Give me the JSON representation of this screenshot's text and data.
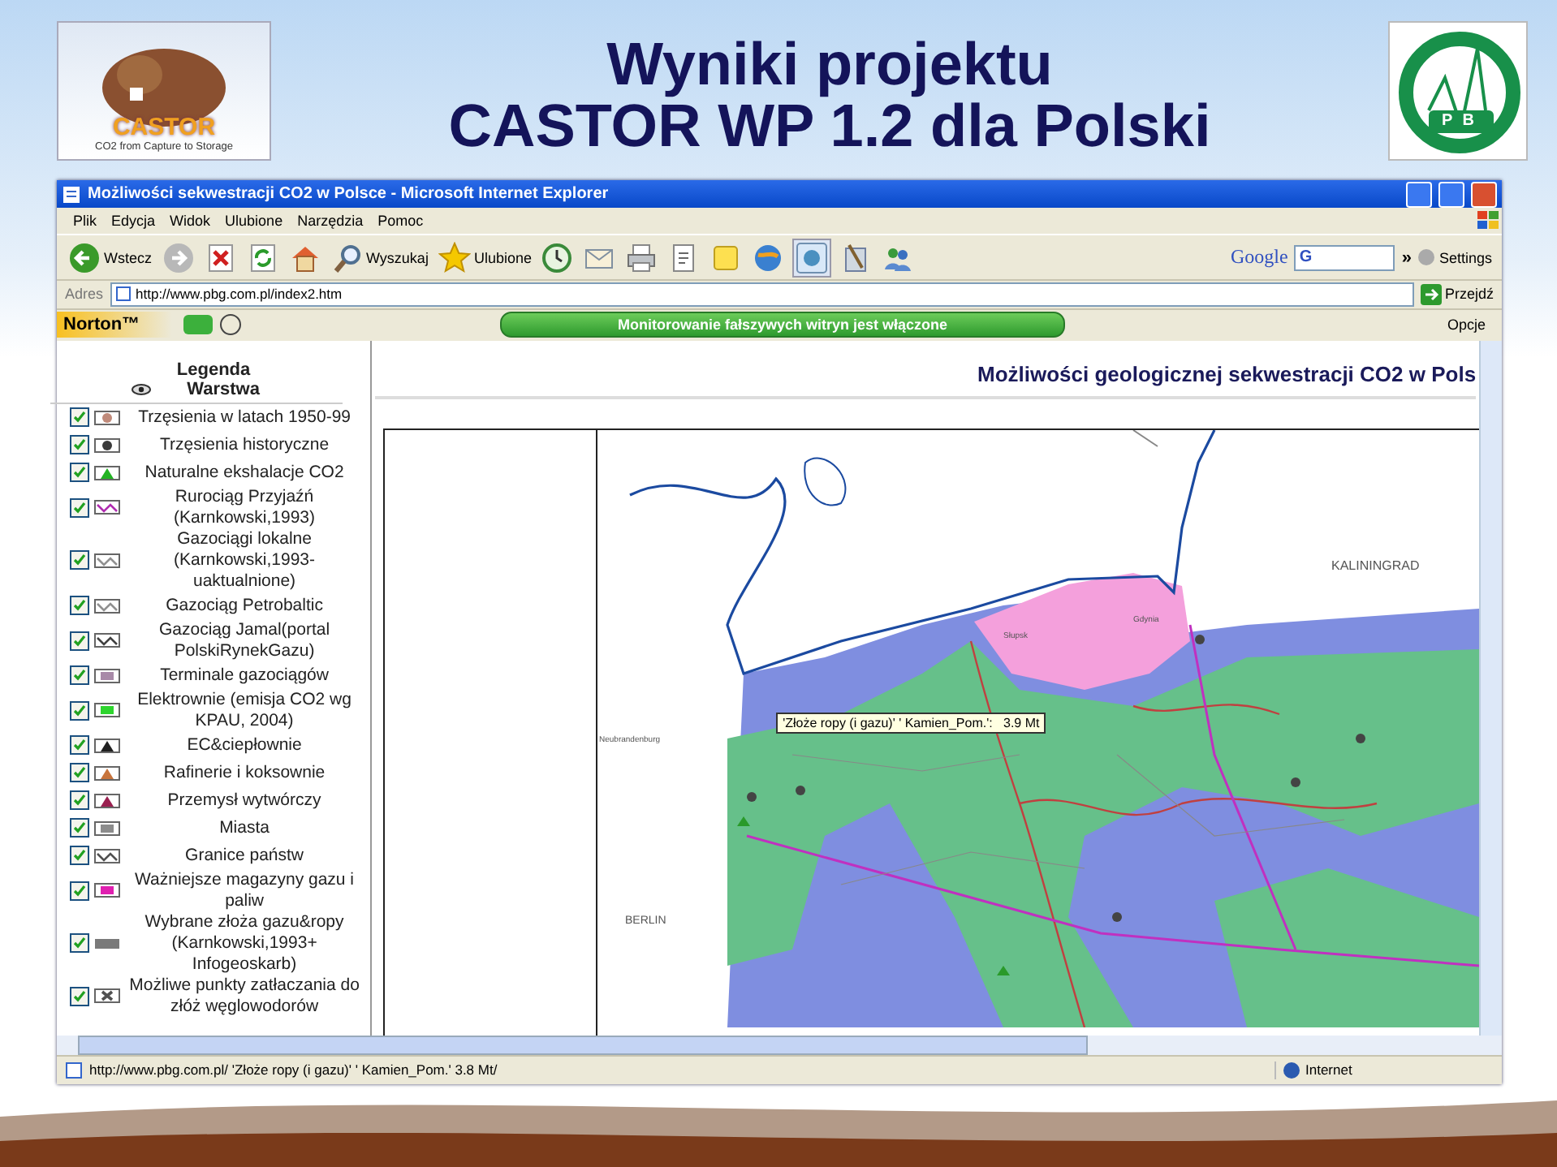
{
  "slide": {
    "title_lines": [
      "Wyniki projektu",
      "CASTOR WP 1.2 dla Polski"
    ],
    "logo_left": {
      "name": "CASTOR",
      "tagline": "CO2 from Capture to Storage"
    },
    "logo_right": {
      "letters": [
        "P",
        "B"
      ]
    }
  },
  "browser": {
    "title": "Możliwości sekwestracji CO2 w Polsce - Microsoft Internet Explorer",
    "menu": [
      "Plik",
      "Edycja",
      "Widok",
      "Ulubione",
      "Narzędzia",
      "Pomoc"
    ],
    "toolbar": [
      {
        "kind": "back",
        "label": "Wstecz"
      },
      {
        "kind": "forward"
      },
      {
        "kind": "stop"
      },
      {
        "kind": "refresh"
      },
      {
        "kind": "home"
      },
      {
        "kind": "search",
        "label": "Wyszukaj"
      },
      {
        "kind": "favorites",
        "label": "Ulubione"
      },
      {
        "kind": "history"
      },
      {
        "kind": "mail"
      },
      {
        "kind": "print"
      },
      {
        "kind": "edit"
      },
      {
        "kind": "note"
      },
      {
        "kind": "messenger"
      },
      {
        "kind": "research"
      },
      {
        "kind": "tools"
      },
      {
        "kind": "people"
      }
    ],
    "google": {
      "label": "Google",
      "field": "G",
      "more": "»",
      "settings": "Settings"
    },
    "address": {
      "label": "Adres",
      "url": "http://www.pbg.com.pl/index2.htm",
      "go": "Przejdź"
    },
    "norton": {
      "label": "Norton™",
      "banner": "Monitorowanie fałszywych witryn jest włączone",
      "options": "Opcje"
    },
    "status": {
      "text": "http://www.pbg.com.pl/ 'Złoże ropy (i gazu)' ' Kamien_Pom.'  3.8 Mt/",
      "zone": "Internet"
    }
  },
  "legend": {
    "title": "Legenda",
    "column": "Warstwa",
    "items": [
      {
        "label": "Trzęsienia w latach 1950-99",
        "checked": true,
        "kind": "dot",
        "color": "#c08a7a"
      },
      {
        "label": "Trzęsienia historyczne",
        "checked": true,
        "kind": "dot",
        "color": "#3a3a3a"
      },
      {
        "label": "Naturalne ekshalacje CO2",
        "checked": true,
        "kind": "triangle",
        "color": "#22b322"
      },
      {
        "label": "Rurociąg Przyjaźń (Karnkowski,1993)",
        "checked": true,
        "kind": "zigzag",
        "color": "#b02cb0"
      },
      {
        "label": "Gazociągi lokalne (Karnkowski,1993-uaktualnione)",
        "checked": true,
        "kind": "zigzag",
        "color": "#909090"
      },
      {
        "label": "Gazociąg Petrobaltic",
        "checked": true,
        "kind": "zigzag",
        "color": "#909090"
      },
      {
        "label": "Gazociąg Jamal(portal PolskiRynekGazu)",
        "checked": true,
        "kind": "zigzag",
        "color": "#404040"
      },
      {
        "label": "Terminale gazociągów",
        "checked": true,
        "kind": "fill",
        "color": "#a88aa8"
      },
      {
        "label": "Elektrownie (emisja CO2 wg KPAU, 2004)",
        "checked": true,
        "kind": "fill",
        "color": "#2ed52e"
      },
      {
        "label": "EC&ciepłownie",
        "checked": true,
        "kind": "triangle",
        "color": "#202020"
      },
      {
        "label": "Rafinerie i koksownie",
        "checked": true,
        "kind": "triangle",
        "color": "#c8743c"
      },
      {
        "label": "Przemysł wytwórczy",
        "checked": true,
        "kind": "triangle",
        "color": "#9a2050"
      },
      {
        "label": "Miasta",
        "checked": true,
        "kind": "fill",
        "color": "#8c8c8c"
      },
      {
        "label": "Granice państw",
        "checked": true,
        "kind": "zigzag",
        "color": "#505050"
      },
      {
        "label": "Ważniejsze magazyny gazu i paliw",
        "checked": true,
        "kind": "fill",
        "color": "#e020b0"
      },
      {
        "label": "Wybrane złoża gazu&ropy (Karnkowski,1993+ Infogeoskarb)",
        "checked": true,
        "kind": "bar",
        "color": "#7a7a7a"
      },
      {
        "label": "Możliwe punkty zatłaczania do złóż węglowodorów",
        "checked": true,
        "kind": "cross",
        "color": "#505050"
      }
    ]
  },
  "map": {
    "title": "Możliwości geologicznej sekwestracji CO2 w Pols",
    "tooltip": "'Złoże ropy (i gazu)' ' Kamien_Pom.':   3.9 Mt",
    "places": [
      {
        "label": "KALININGRAD"
      },
      {
        "label": "BERLIN"
      },
      {
        "label": "Neubrandenburg"
      },
      {
        "label": "Słupsk"
      },
      {
        "label": "Gdynia"
      }
    ]
  }
}
